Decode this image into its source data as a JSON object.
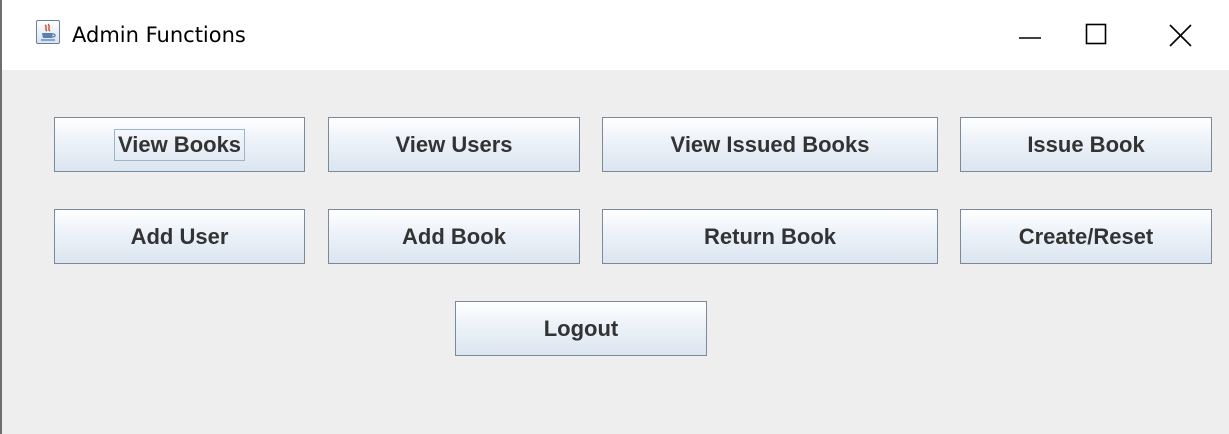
{
  "window": {
    "title": "Admin Functions",
    "app_icon": "java-icon",
    "controls": {
      "minimize_icon": "minimize-icon",
      "maximize_icon": "maximize-icon",
      "close_icon": "close-icon"
    }
  },
  "buttons": {
    "view_books": "View Books",
    "view_users": "View Users",
    "view_issued_books": "View Issued Books",
    "issue_book": "Issue Book",
    "add_user": "Add User",
    "add_book": "Add Book",
    "return_book": "Return Book",
    "create_reset": "Create/Reset",
    "logout": "Logout"
  },
  "colors": {
    "window_background": "#eeeeee",
    "titlebar_background": "#ffffff",
    "button_text": "#333333",
    "button_border": "#7a8a99"
  }
}
